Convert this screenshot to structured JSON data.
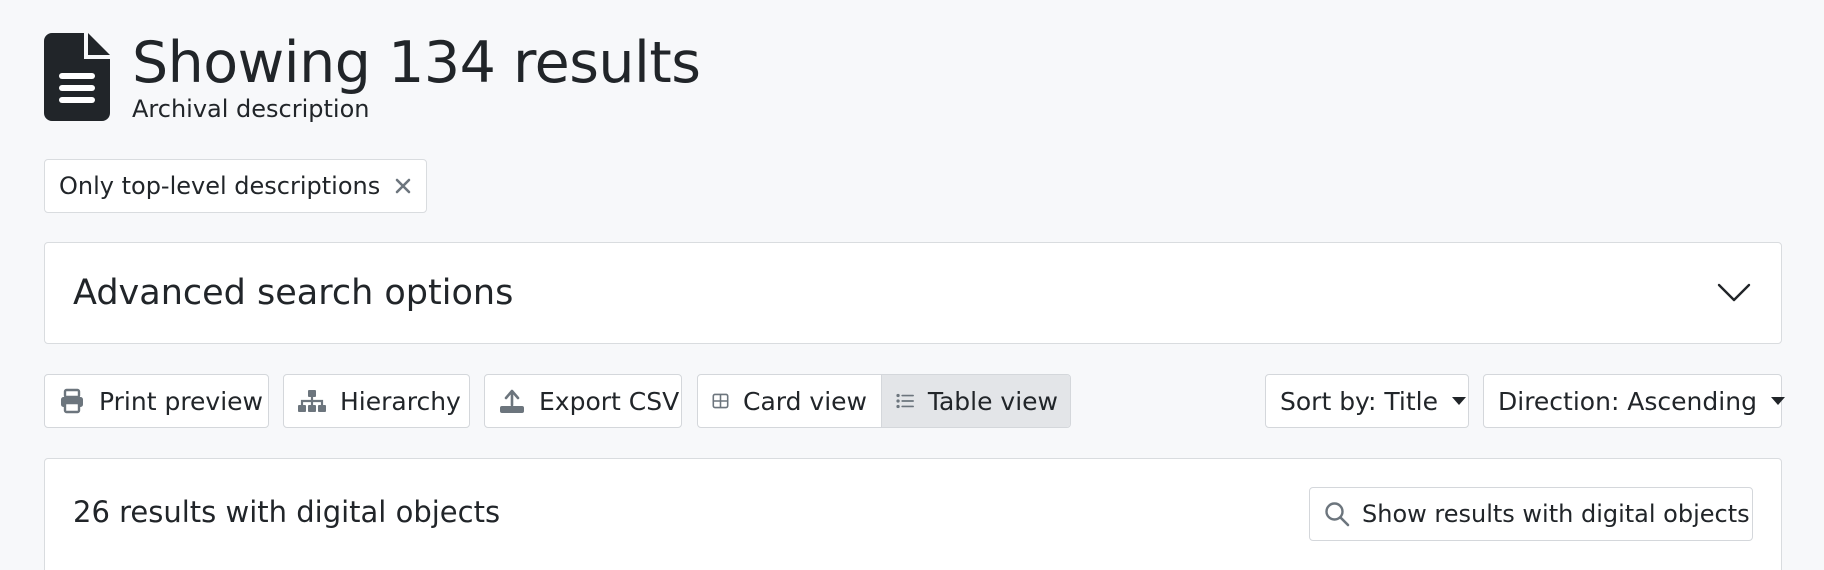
{
  "header": {
    "title": "Showing 134 results",
    "subtitle": "Archival description",
    "icon": "file-text-icon"
  },
  "filters": [
    {
      "label": "Only top-level descriptions",
      "remove_icon": "close-icon"
    }
  ],
  "advanced_search": {
    "title": "Advanced search options",
    "icon": "chevron-down-icon"
  },
  "toolbar": {
    "print_preview": "Print preview",
    "hierarchy": "Hierarchy",
    "export_csv": "Export CSV",
    "card_view": "Card view",
    "table_view": "Table view",
    "active_view": "Table view",
    "sort": "Sort by: Title",
    "direction": "Direction: Ascending"
  },
  "results": {
    "digital_count_text": "26 results with digital objects",
    "show_digital_label": "Show results with digital objects"
  }
}
